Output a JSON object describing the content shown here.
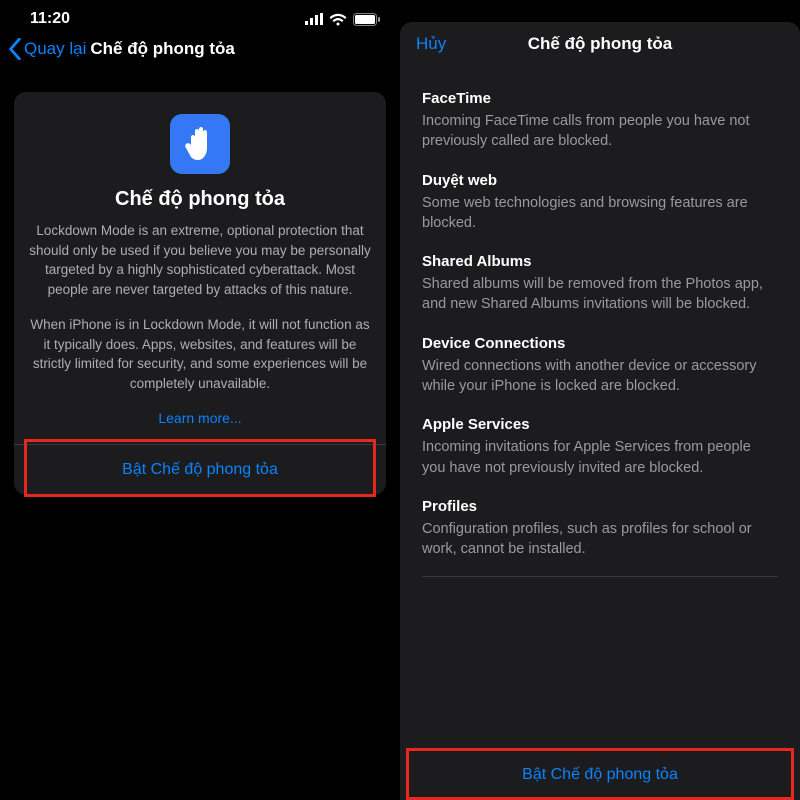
{
  "left": {
    "status": {
      "time": "11:20"
    },
    "nav": {
      "back": "Quay lại",
      "title": "Chế độ phong tỏa"
    },
    "card": {
      "title": "Chế độ phong tỏa",
      "para1": "Lockdown Mode is an extreme, optional protection that should only be used if you believe you may be personally targeted by a highly sophisticated cyberattack. Most people are never targeted by attacks of this nature.",
      "para2": "When iPhone is in Lockdown Mode, it will not function as it typically does. Apps, websites, and features will be strictly limited for security, and some experiences will be completely unavailable.",
      "learn_more": "Learn more...",
      "enable": "Bật Chế độ phong tỏa"
    }
  },
  "right": {
    "sheet": {
      "cancel": "Hủy",
      "title": "Chế độ phong tỏa",
      "enable": "Bật Chế độ phong tỏa"
    },
    "sections": [
      {
        "title": "FaceTime",
        "body": "Incoming FaceTime calls from people you have not previously called are blocked."
      },
      {
        "title": "Duyệt web",
        "body": "Some web technologies and browsing features are blocked."
      },
      {
        "title": "Shared Albums",
        "body": "Shared albums will be removed from the Photos app, and new Shared Albums invitations will be blocked."
      },
      {
        "title": "Device Connections",
        "body": "Wired connections with another device or accessory while your iPhone is locked are blocked."
      },
      {
        "title": "Apple Services",
        "body": "Incoming invitations for Apple Services from people you have not previously invited are blocked."
      },
      {
        "title": "Profiles",
        "body": "Configuration profiles, such as profiles for school or work, cannot be installed."
      }
    ]
  }
}
